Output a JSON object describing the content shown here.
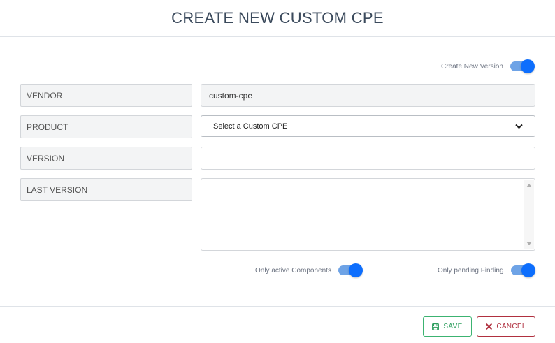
{
  "modal": {
    "title": "CREATE NEW CUSTOM CPE"
  },
  "toggles": {
    "create_new_version": {
      "label": "Create New Version",
      "on": true
    },
    "only_active_components": {
      "label": "Only active Components",
      "on": true
    },
    "only_pending_finding": {
      "label": "Only pending Finding",
      "on": true
    }
  },
  "form": {
    "vendor": {
      "label": "VENDOR",
      "value": "custom-cpe"
    },
    "product": {
      "label": "PRODUCT",
      "selected": "Select a Custom CPE"
    },
    "version": {
      "label": "VERSION",
      "value": ""
    },
    "last_version": {
      "label": "LAST VERSION",
      "value": ""
    }
  },
  "footer": {
    "save_label": "SAVE",
    "cancel_label": "CANCEL"
  },
  "colors": {
    "accent": "#0d6efd",
    "save": "#2e9e5e",
    "cancel": "#b0303f"
  },
  "icons": {
    "save": "floppy-disk-icon",
    "cancel": "x-mark-icon",
    "product_select": "chevron-down-icon"
  }
}
